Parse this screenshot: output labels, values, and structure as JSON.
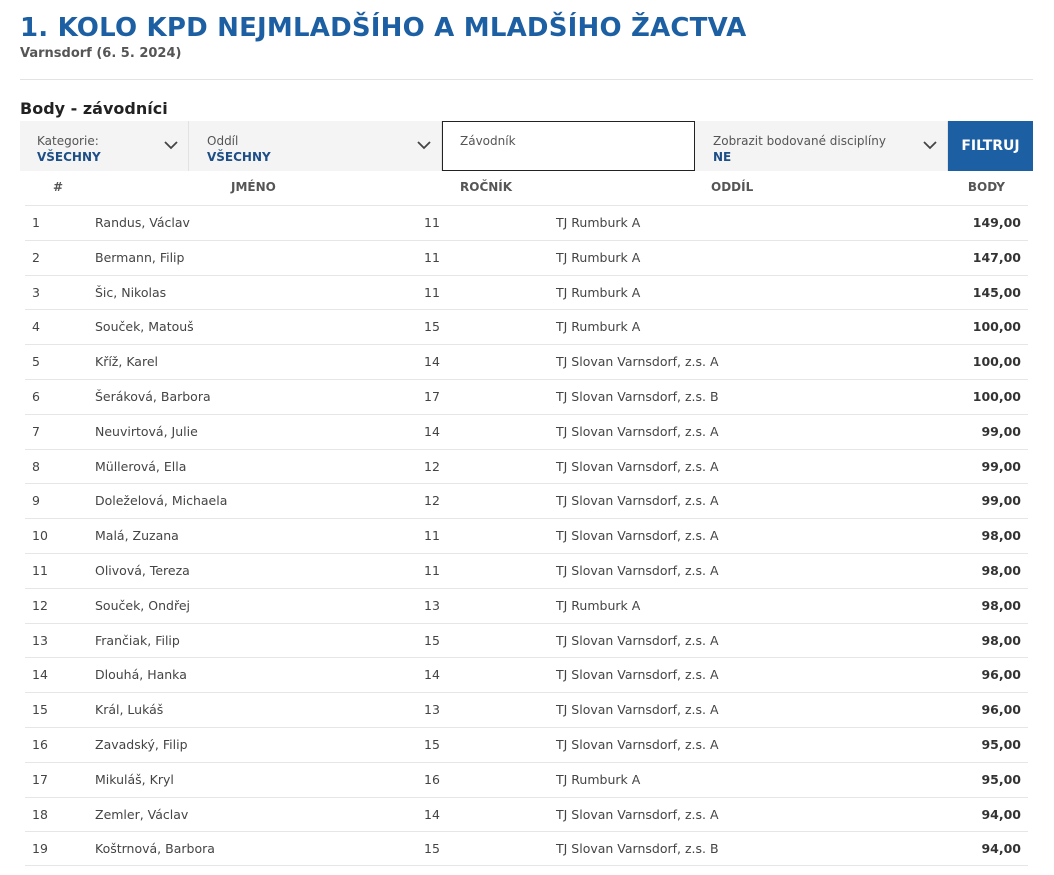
{
  "header": {
    "title": "1. KOLO KPD NEJMLADŠÍHO A MLADŠÍHO ŽACTVA",
    "subtitle": "Varnsdorf (6. 5. 2024)",
    "section": "Body - závodníci"
  },
  "filters": {
    "kategorie": {
      "label": "Kategorie:",
      "value": "VŠECHNY"
    },
    "oddil": {
      "label": "Oddíl",
      "value": "VŠECHNY"
    },
    "zavodnik": {
      "label": "Závodník"
    },
    "zobrazit": {
      "label": "Zobrazit bodované disciplíny",
      "value": "NE"
    },
    "button": "FILTRUJ"
  },
  "table": {
    "headers": {
      "rank": "#",
      "name": "JMÉNO",
      "year": "ROČNÍK",
      "club": "ODDÍL",
      "points": "BODY"
    },
    "rows": [
      {
        "rank": "1",
        "name": "Randus, Václav",
        "year": "11",
        "club": "TJ Rumburk A",
        "points": "149,00"
      },
      {
        "rank": "2",
        "name": "Bermann, Filip",
        "year": "11",
        "club": "TJ Rumburk A",
        "points": "147,00"
      },
      {
        "rank": "3",
        "name": "Šic, Nikolas",
        "year": "11",
        "club": "TJ Rumburk A",
        "points": "145,00"
      },
      {
        "rank": "4",
        "name": "Souček, Matouš",
        "year": "15",
        "club": "TJ Rumburk A",
        "points": "100,00"
      },
      {
        "rank": "5",
        "name": "Kříž, Karel",
        "year": "14",
        "club": "TJ Slovan Varnsdorf, z.s. A",
        "points": "100,00"
      },
      {
        "rank": "6",
        "name": "Šeráková, Barbora",
        "year": "17",
        "club": "TJ Slovan Varnsdorf, z.s. B",
        "points": "100,00"
      },
      {
        "rank": "7",
        "name": "Neuvirtová, Julie",
        "year": "14",
        "club": "TJ Slovan Varnsdorf, z.s. A",
        "points": "99,00"
      },
      {
        "rank": "8",
        "name": "Müllerová, Ella",
        "year": "12",
        "club": "TJ Slovan Varnsdorf, z.s. A",
        "points": "99,00"
      },
      {
        "rank": "9",
        "name": "Doleželová, Michaela",
        "year": "12",
        "club": "TJ Slovan Varnsdorf, z.s. A",
        "points": "99,00"
      },
      {
        "rank": "10",
        "name": "Malá, Zuzana",
        "year": "11",
        "club": "TJ Slovan Varnsdorf, z.s. A",
        "points": "98,00"
      },
      {
        "rank": "11",
        "name": "Olivová, Tereza",
        "year": "11",
        "club": "TJ Slovan Varnsdorf, z.s. A",
        "points": "98,00"
      },
      {
        "rank": "12",
        "name": "Souček, Ondřej",
        "year": "13",
        "club": "TJ Rumburk A",
        "points": "98,00"
      },
      {
        "rank": "13",
        "name": "Frančiak, Filip",
        "year": "15",
        "club": "TJ Slovan Varnsdorf, z.s. A",
        "points": "98,00"
      },
      {
        "rank": "14",
        "name": "Dlouhá, Hanka",
        "year": "14",
        "club": "TJ Slovan Varnsdorf, z.s. A",
        "points": "96,00"
      },
      {
        "rank": "15",
        "name": "Král, Lukáš",
        "year": "13",
        "club": "TJ Slovan Varnsdorf, z.s. A",
        "points": "96,00"
      },
      {
        "rank": "16",
        "name": "Zavadský, Filip",
        "year": "15",
        "club": "TJ Slovan Varnsdorf, z.s. A",
        "points": "95,00"
      },
      {
        "rank": "17",
        "name": "Mikuláš, Kryl",
        "year": "16",
        "club": "TJ Rumburk A",
        "points": "95,00"
      },
      {
        "rank": "18",
        "name": "Zemler, Václav",
        "year": "14",
        "club": "TJ Slovan Varnsdorf, z.s. A",
        "points": "94,00"
      },
      {
        "rank": "19",
        "name": "Koštrnová, Barbora",
        "year": "15",
        "club": "TJ Slovan Varnsdorf, z.s. B",
        "points": "94,00"
      }
    ]
  },
  "colors": {
    "brand": "#1d5fa3",
    "accent_text": "#1d4f86",
    "filter_bg": "#f4f4f4"
  },
  "icons": {
    "dropdown": "chevron-down-icon"
  }
}
